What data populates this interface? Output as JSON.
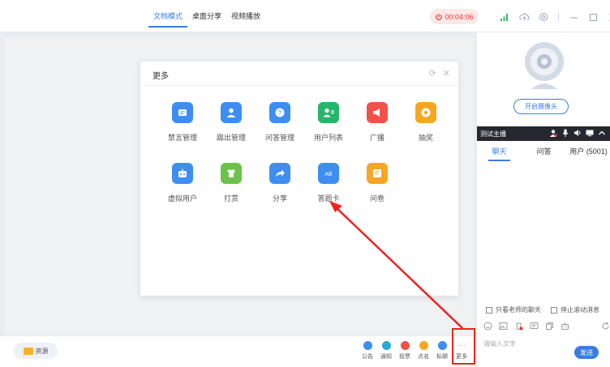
{
  "topbar": {
    "tabs": [
      {
        "label": "文档模式",
        "active": true
      },
      {
        "label": "桌面分享",
        "active": false
      },
      {
        "label": "视频播放",
        "active": false
      }
    ],
    "timer": "00:04:06"
  },
  "modal": {
    "title": "更多",
    "items": [
      {
        "label": "禁言管理",
        "color": "#3d8ef0",
        "icon": "mute-manage-icon"
      },
      {
        "label": "踢出管理",
        "color": "#3d8ef0",
        "icon": "kick-user-icon"
      },
      {
        "label": "问答管理",
        "color": "#3d8ef0",
        "icon": "qa-manage-icon"
      },
      {
        "label": "用户列表",
        "color": "#28b46a",
        "icon": "user-list-icon"
      },
      {
        "label": "广播",
        "color": "#f0524a",
        "icon": "broadcast-icon"
      },
      {
        "label": "抽奖",
        "color": "#f5a623",
        "icon": "lottery-icon"
      },
      {
        "label": "虚拟用户",
        "color": "#3d8ef0",
        "icon": "virtual-user-icon"
      },
      {
        "label": "打赏",
        "color": "#6cc24a",
        "icon": "reward-icon"
      },
      {
        "label": "分享",
        "color": "#3d8ef0",
        "icon": "share-icon"
      },
      {
        "label": "答题卡",
        "color": "#3d8ef0",
        "icon": "answer-card-icon"
      },
      {
        "label": "问卷",
        "color": "#f5a623",
        "icon": "questionnaire-icon"
      }
    ]
  },
  "right": {
    "camera_button": "开启摄像头",
    "host_name": "测试主播",
    "tabs": [
      {
        "label": "聊天",
        "active": true
      },
      {
        "label": "问答",
        "active": false
      },
      {
        "label": "用户 (5001)",
        "active": false
      }
    ],
    "only_teacher": "只看老师的聊天",
    "stop_scroll": "停止滚动消息",
    "input_placeholder": "请输入文字",
    "send_label": "发送"
  },
  "bottom": {
    "resource_label": "资源",
    "tools": [
      {
        "label": "公告",
        "color": "#3d8ef0"
      },
      {
        "label": "通知",
        "color": "#2aa8d8"
      },
      {
        "label": "投票",
        "color": "#f0524a"
      },
      {
        "label": "点名",
        "color": "#f5a623"
      },
      {
        "label": "私聊",
        "color": "#3d8ef0"
      },
      {
        "label": "更多",
        "color": "#999999"
      }
    ]
  }
}
